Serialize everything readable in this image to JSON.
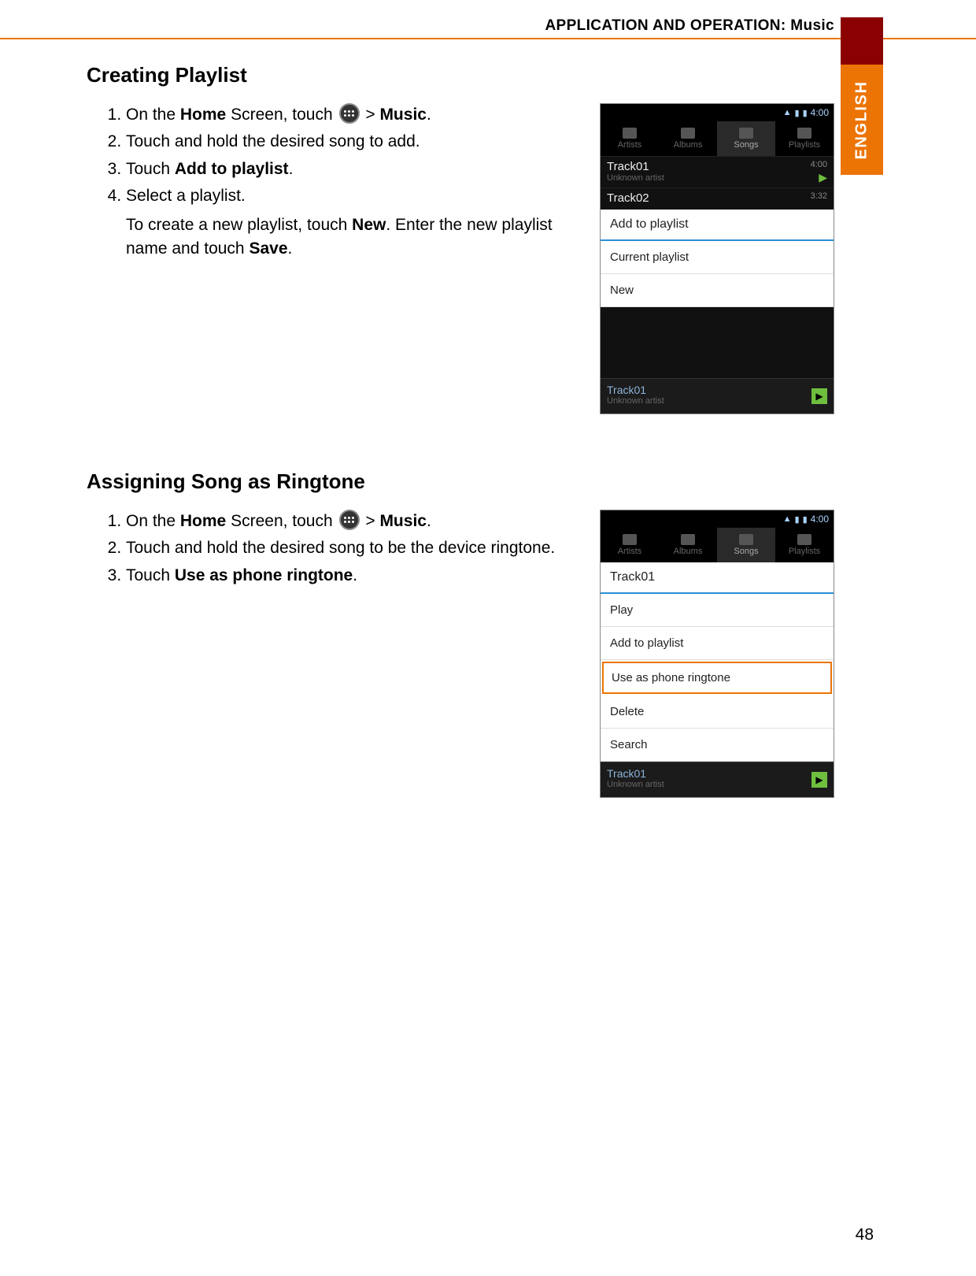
{
  "header": {
    "title": "APPLICATION AND OPERATION: Music",
    "language_tab": "ENGLISH"
  },
  "page_number": "48",
  "section1": {
    "heading": "Creating Playlist",
    "steps": {
      "s1_pre": "On the ",
      "s1_home": "Home",
      "s1_mid": " Screen, touch ",
      "s1_gt": "  > ",
      "s1_music": "Music",
      "s1_end": ".",
      "s2": "Touch and hold the desired song to add.",
      "s3_pre": "Touch ",
      "s3_bold": "Add to playlist",
      "s3_end": ".",
      "s4": "Select a playlist.",
      "s4_note_pre": "To create a new playlist, touch ",
      "s4_note_new": "New",
      "s4_note_mid": ". Enter the new playlist name and touch ",
      "s4_note_save": "Save",
      "s4_note_end": "."
    }
  },
  "section2": {
    "heading": "Assigning Song as Ringtone",
    "steps": {
      "s1_pre": "On the ",
      "s1_home": "Home",
      "s1_mid": " Screen, touch ",
      "s1_gt": "  > ",
      "s1_music": "Music",
      "s1_end": ".",
      "s2": "Touch and hold the desired song to be the device ringtone.",
      "s3_pre": "Touch ",
      "s3_bold": "Use as phone ringtone",
      "s3_end": "."
    }
  },
  "phone_common": {
    "time": "4:00",
    "tabs": {
      "artists": "Artists",
      "albums": "Albums",
      "songs": "Songs",
      "playlists": "Playlists"
    },
    "unknown_artist": "Unknown artist"
  },
  "phone1": {
    "track1": {
      "name": "Track01",
      "time": "4:00"
    },
    "track2": {
      "name": "Track02",
      "time": "3:32"
    },
    "menu_title": "Add to playlist",
    "menu_item1": "Current playlist",
    "menu_item2": "New",
    "nowplaying": "Track01"
  },
  "phone2": {
    "menu_title": "Track01",
    "menu_items": {
      "play": "Play",
      "add": "Add to playlist",
      "ringtone": "Use as phone ringtone",
      "delete": "Delete",
      "search": "Search"
    },
    "nowplaying": "Track01"
  }
}
